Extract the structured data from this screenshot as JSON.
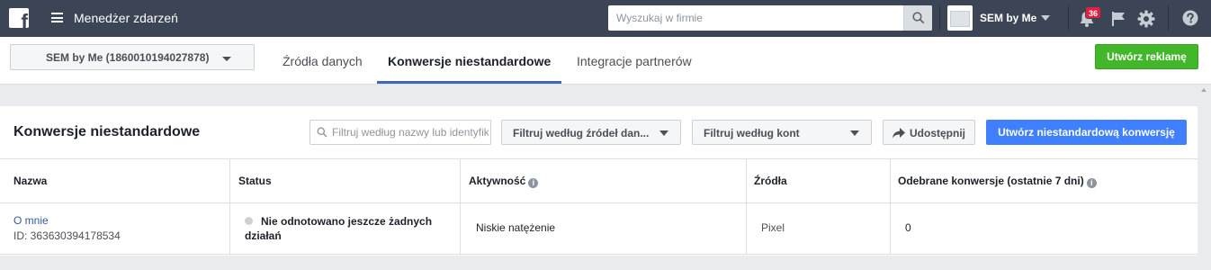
{
  "topbar": {
    "logo_letter": "f",
    "app_title": "Menedżer zdarzeń",
    "search_placeholder": "Wyszukaj w firmie",
    "account_name": "SEM by Me",
    "notifications_count": "36"
  },
  "subnav": {
    "account_selector": "SEM by Me (1860010194027878)",
    "tabs": [
      {
        "label": "Źródła danych",
        "active": false
      },
      {
        "label": "Konwersje niestandardowe",
        "active": true
      },
      {
        "label": "Integracje partnerów",
        "active": false
      }
    ],
    "create_ad_label": "Utwórz reklamę"
  },
  "card": {
    "title": "Konwersje niestandardowe",
    "filter_placeholder": "Filtruj według nazwy lub identyfikatora",
    "filter_sources_label": "Filtruj według źródeł dan...",
    "filter_accounts_label": "Filtruj według kont",
    "share_label": "Udostępnij",
    "create_conversion_label": "Utwórz niestandardową konwersję"
  },
  "table": {
    "columns": [
      "Nazwa",
      "Status",
      "Aktywność",
      "Źródła",
      "Odebrane konwersje (ostatnie 7 dni)"
    ],
    "rows": [
      {
        "name": "O mnie",
        "id": "ID: 363630394178534",
        "status_line1": "Nie odnotowano jeszcze żadnych",
        "status_line2": "działań",
        "activity": "Niskie natężenie",
        "source": "Pixel",
        "conversions": "0"
      }
    ]
  },
  "colors": {
    "topbar": "#3b4555",
    "tab_underline": "#4267b2",
    "create_ad": "#42b72a",
    "primary_button": "#4080ff",
    "badge": "#e41e3f",
    "link": "#365899"
  }
}
